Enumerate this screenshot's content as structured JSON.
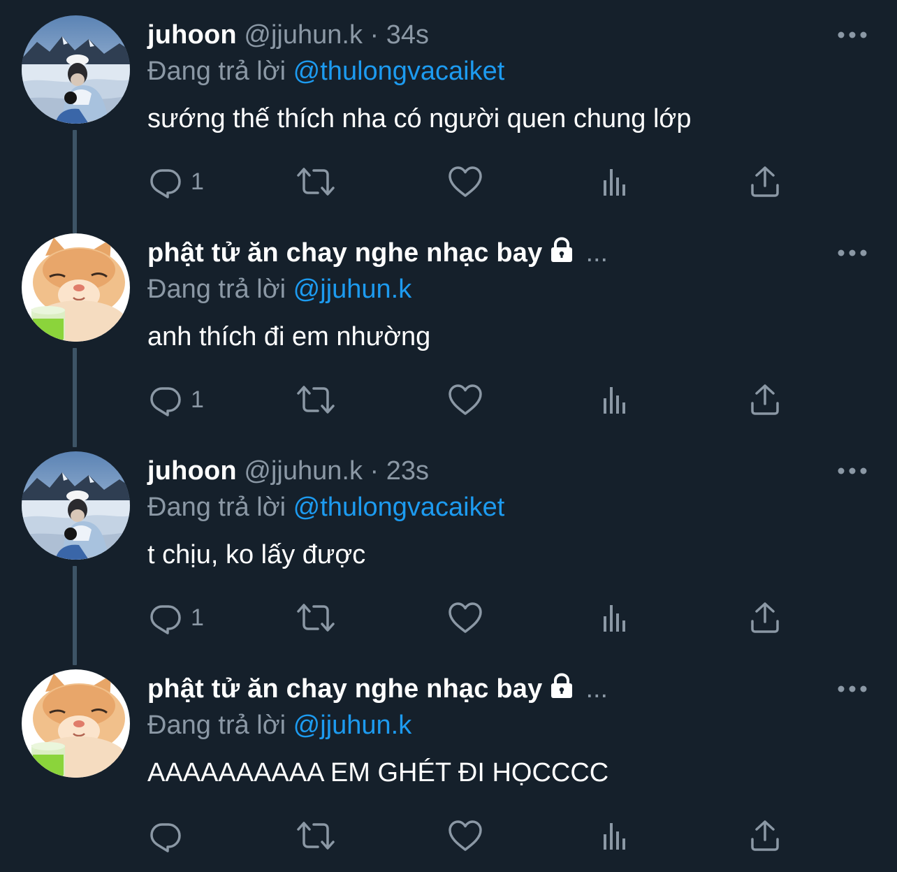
{
  "theme": {
    "background": "#15202b",
    "text": "#ffffff",
    "muted": "#8b98a5",
    "accent": "#1d9bf0",
    "thread_line": "#3d5466"
  },
  "tweets": [
    {
      "name": "juhoon",
      "handle": "@jjuhun.k",
      "dot": "·",
      "time": "34s",
      "protected": false,
      "reply_prefix": "Đang trả lời",
      "reply_to": "@thulongvacaiket",
      "text": "sướng thế thích nha có người quen chung lớp",
      "reply_count": "1",
      "avatar": "snow-landscape-photo",
      "icons": [
        "reply-icon",
        "retweet-icon",
        "like-icon",
        "views-icon",
        "share-icon",
        "more-icon"
      ]
    },
    {
      "name": "phật tử ăn chay nghe nhạc bay",
      "truncation": "...",
      "protected": true,
      "reply_prefix": "Đang trả lời",
      "reply_to": "@jjuhun.k",
      "text": "anh thích đi em nhường",
      "reply_count": "1",
      "avatar": "cat-with-drink-photo",
      "icons": [
        "reply-icon",
        "retweet-icon",
        "like-icon",
        "views-icon",
        "share-icon",
        "more-icon",
        "lock-icon"
      ]
    },
    {
      "name": "juhoon",
      "handle": "@jjuhun.k",
      "dot": "·",
      "time": "23s",
      "protected": false,
      "reply_prefix": "Đang trả lời",
      "reply_to": "@thulongvacaiket",
      "text": "t chịu, ko lấy được",
      "reply_count": "1",
      "avatar": "snow-landscape-photo",
      "icons": [
        "reply-icon",
        "retweet-icon",
        "like-icon",
        "views-icon",
        "share-icon",
        "more-icon"
      ]
    },
    {
      "name": "phật tử ăn chay nghe nhạc bay",
      "truncation": "...",
      "protected": true,
      "reply_prefix": "Đang trả lời",
      "reply_to": "@jjuhun.k",
      "text": "AAAAAAAAAA EM GHÉT ĐI HỌCCCC",
      "reply_count": "",
      "avatar": "cat-with-drink-photo",
      "icons": [
        "reply-icon",
        "retweet-icon",
        "like-icon",
        "views-icon",
        "share-icon",
        "more-icon",
        "lock-icon"
      ]
    }
  ]
}
